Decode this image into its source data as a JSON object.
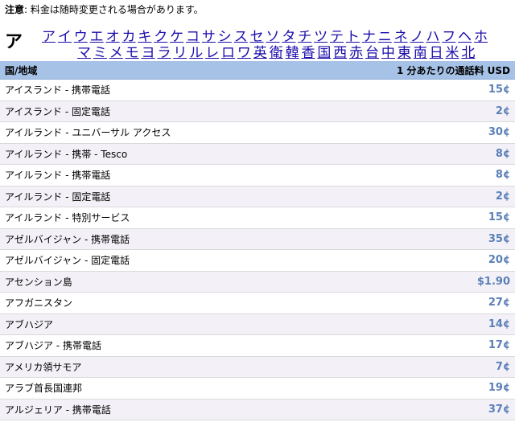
{
  "notice": {
    "label": "注意",
    "text": ": 料金は随時変更される場合があります。"
  },
  "section": {
    "letter": "ア"
  },
  "index": {
    "line1": [
      "ア",
      "イ",
      "ウ",
      "エ",
      "オ",
      "カ",
      "キ",
      "ク",
      "ケ",
      "コ",
      "サ",
      "シ",
      "ス",
      "セ",
      "ソ",
      "タ",
      "チ",
      "ツ",
      "テ",
      "ト",
      "ナ",
      "ニ",
      "ネ",
      "ノ",
      "ハ",
      "フ",
      "ヘ",
      "ホ"
    ],
    "line2": [
      "マ",
      "ミ",
      "メ",
      "モ",
      "ヨ",
      "ラ",
      "リ",
      "ル",
      "レ",
      "ロ",
      "ワ",
      "英",
      "衛",
      "韓",
      "香",
      "国",
      "西",
      "赤",
      "台",
      "中",
      "東",
      "南",
      "日",
      "米",
      "北"
    ]
  },
  "table": {
    "header_country": "国/地域",
    "header_rate": "1 分あたりの通話料 USD",
    "rows": [
      {
        "country": "アイスランド - 携帯電話",
        "rate": "15¢"
      },
      {
        "country": "アイスランド - 固定電話",
        "rate": "2¢"
      },
      {
        "country": "アイルランド - ユニバーサル アクセス",
        "rate": "30¢"
      },
      {
        "country": "アイルランド - 携帯 - Tesco",
        "rate": "8¢"
      },
      {
        "country": "アイルランド - 携帯電話",
        "rate": "8¢"
      },
      {
        "country": "アイルランド - 固定電話",
        "rate": "2¢"
      },
      {
        "country": "アイルランド - 特別サービス",
        "rate": "15¢"
      },
      {
        "country": "アゼルバイジャン - 携帯電話",
        "rate": "35¢"
      },
      {
        "country": "アゼルバイジャン - 固定電話",
        "rate": "20¢"
      },
      {
        "country": "アセンション島",
        "rate": "$1.90"
      },
      {
        "country": "アフガニスタン",
        "rate": "27¢"
      },
      {
        "country": "アブハジア",
        "rate": "14¢"
      },
      {
        "country": "アブハジア - 携帯電話",
        "rate": "17¢"
      },
      {
        "country": "アメリカ領サモア",
        "rate": "7¢"
      },
      {
        "country": "アラブ首長国連邦",
        "rate": "19¢"
      },
      {
        "country": "アルジェリア - 携帯電話",
        "rate": "37¢"
      }
    ]
  }
}
